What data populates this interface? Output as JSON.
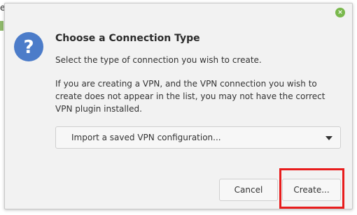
{
  "background": {
    "partial_char": "e"
  },
  "dialog": {
    "close_icon": "×",
    "icon": "question-icon",
    "title": "Choose a Connection Type",
    "subtitle": "Select the type of connection you wish to create.",
    "info": "If you are creating a VPN, and the VPN connection you wish to create does not appear in the list, you may not have the correct VPN plugin installed.",
    "combo": {
      "selected": "Import a saved VPN configuration..."
    },
    "buttons": {
      "cancel": "Cancel",
      "create": "Create..."
    }
  },
  "colors": {
    "close_button": "#79b84c",
    "question_icon": "#4c7cc9",
    "highlight": "#e81c1c"
  }
}
